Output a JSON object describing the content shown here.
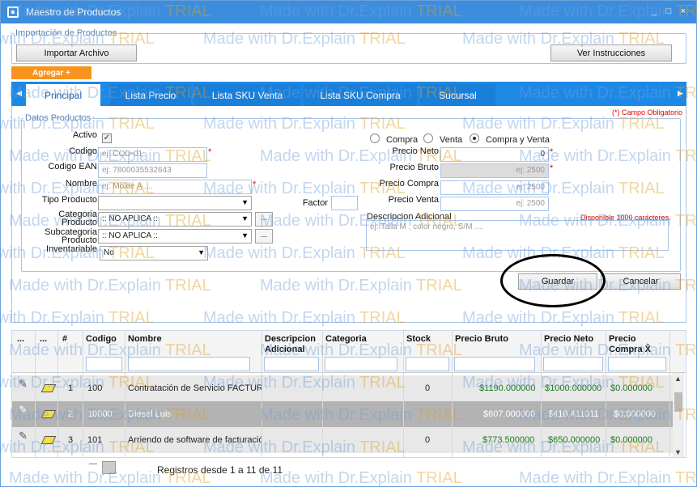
{
  "window": {
    "title": "Maestro de Productos",
    "minimize": "_",
    "maximize": "□",
    "close": "×"
  },
  "import": {
    "legend": "Importación de Productos",
    "import_button": "Importar Archivo",
    "instructions_button": "Ver Instrucciones"
  },
  "add_button": "Agregar +",
  "tabs": [
    {
      "label": "Principal",
      "active": true
    },
    {
      "label": "Lista Precio",
      "active": false
    },
    {
      "label": "Lista SKU Venta",
      "active": false
    },
    {
      "label": "Lista SKU Compra",
      "active": false
    },
    {
      "label": "Sucursal",
      "active": false
    }
  ],
  "required_note": "(*) Campo Obligatorio",
  "form": {
    "legend": "Datos Productos",
    "activo_label": "Activo",
    "activo_checked": true,
    "codigo_label": "Codigo",
    "codigo_placeholder": "ej:  COD-01",
    "codigo_ean_label": "Codigo EAN",
    "codigo_ean_placeholder": "ej:  7800035532643",
    "nombre_label": "Nombre",
    "nombre_placeholder": "ej: Molde A ....",
    "tipo_label": "Tipo Producto",
    "tipo_value": "",
    "factor_label": "Factor",
    "categoria_label_1": "Categoria",
    "categoria_label_2": "Producto",
    "categoria_value": ":: NO APLICA ::",
    "subcategoria_label_1": "Subcategoria",
    "subcategoria_label_2": "Producto",
    "subcategoria_value": ":: NO APLICA ::",
    "inventariable_label": "Inventariable",
    "inventariable_value": "No",
    "ellipsis_button": "...",
    "radio_compra": "Compra",
    "radio_venta": "Venta",
    "radio_compra_venta": "Compra y Venta",
    "radio_selected": "compra_venta",
    "precio_neto_label": "Precio Neto",
    "precio_neto_value": "0",
    "precio_bruto_label": "Precio Bruto",
    "precio_bruto_placeholder": "ej: 2500",
    "precio_compra_label": "Precio Compra",
    "precio_compra_placeholder": "ej: 2500",
    "precio_venta_label": "Precio Venta",
    "precio_venta_placeholder": "ej: 2500",
    "descripcion_label": "Descripcion Adicional",
    "descripcion_note": "Disponible 1000 caracteres.",
    "descripcion_placeholder": "ej: Talla M , color negro, S/M  ...."
  },
  "actions": {
    "save": "Guardar",
    "cancel": "Cancelar"
  },
  "grid": {
    "headers": {
      "c1": "...",
      "c2": "...",
      "num": "#",
      "codigo": "Codigo",
      "nombre": "Nombre",
      "desc1": "Descripcion",
      "desc2": "Adicional",
      "categoria": "Categoria",
      "stock": "Stock",
      "precio_bruto": "Precio Bruto",
      "precio_neto": "Precio Neto",
      "precio_compra1": "Precio",
      "precio_compra2": "Compra X̄"
    },
    "rows": [
      {
        "num": "1",
        "codigo": "100",
        "nombre": "Contratación de Servicio FACTURA",
        "descripcion": "",
        "categoria": "",
        "stock": "0",
        "precio_bruto": "$1190.000000",
        "precio_neto": "$1000.000000",
        "precio_compra": "$0.000000",
        "selected": false
      },
      {
        "num": "2",
        "codigo": "10000",
        "nombre": "Diesel Luis",
        "descripcion": "",
        "categoria": "",
        "stock": "",
        "precio_bruto": "$607.000000",
        "precio_neto": "$416.411011",
        "precio_compra": "$0.000000",
        "selected": true
      },
      {
        "num": "3",
        "codigo": "101",
        "nombre": "Arriendo de software de facturació",
        "descripcion": "",
        "categoria": "",
        "stock": "0",
        "precio_bruto": "$773.500000",
        "precio_neto": "$650.000000",
        "precio_compra": "$0.000000",
        "selected": false
      }
    ]
  },
  "footer": {
    "records": "Registros desde 1 a 11 de 11"
  },
  "watermark": {
    "part1": "Made with ",
    "part2": "Dr.Explain ",
    "part3": "TRIAL"
  }
}
